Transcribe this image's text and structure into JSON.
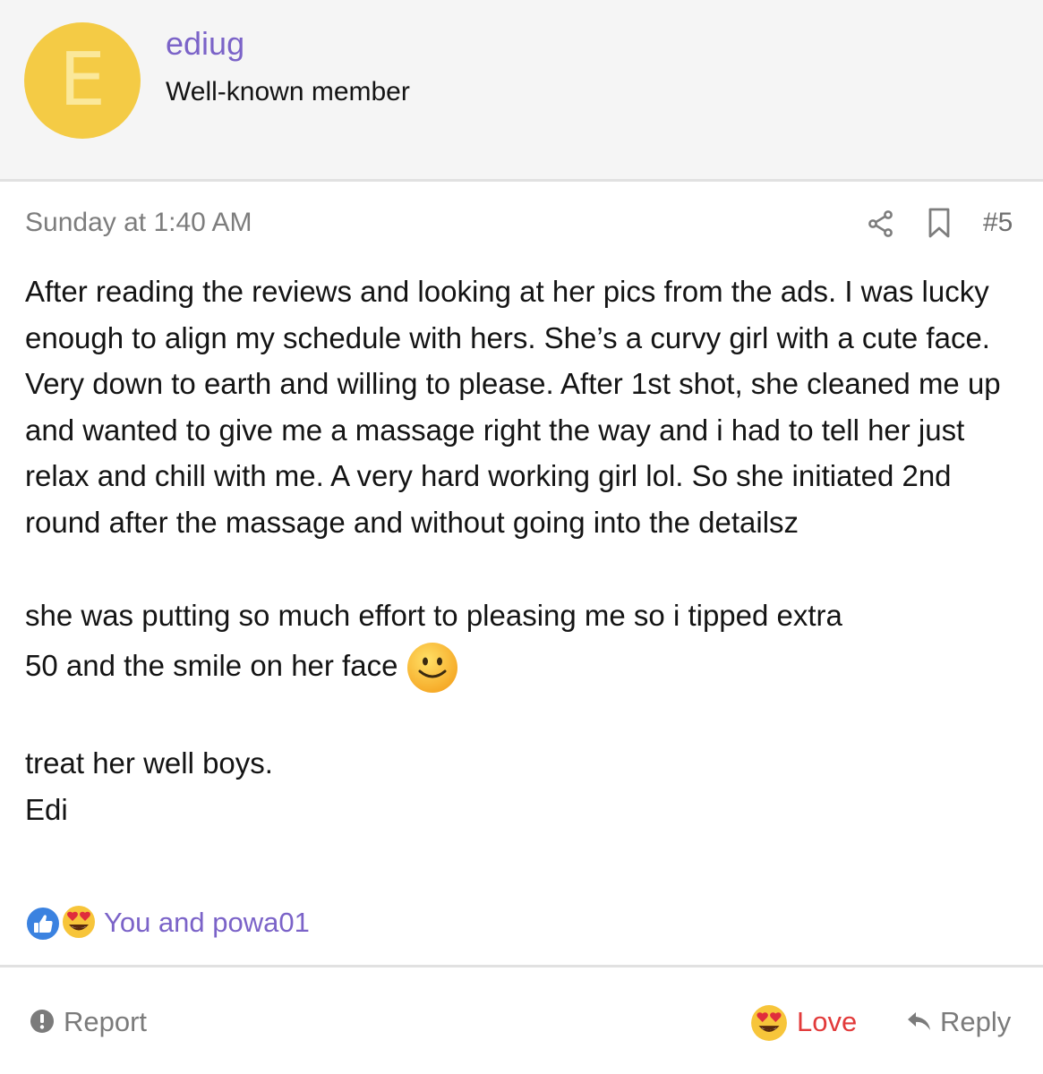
{
  "user": {
    "avatar_letter": "E",
    "name": "ediug",
    "title": "Well-known member"
  },
  "post": {
    "date": "Sunday at 1:40 AM",
    "number": "#5",
    "paragraph1": "After reading the reviews and looking at her pics from the ads. I was lucky enough to align my schedule with hers. She’s a curvy girl with a cute face. Very down to earth and willing to please. After 1st shot, she cleaned me up and wanted to give me a massage right the way and i had to tell her just relax and chill with me. A very hard working girl lol. So she initiated 2nd round after the massage and without going into the detailsz",
    "paragraph2_line1": "she was putting so much effort to pleasing me so i tipped extra",
    "paragraph2_line2": "50 and the smile on her face",
    "paragraph3_line1": "treat her well boys.",
    "paragraph3_line2": "Edi"
  },
  "reactions": {
    "text": "You and powa01",
    "icons": [
      "like-icon",
      "love-eyes-icon"
    ]
  },
  "actions": {
    "report": "Report",
    "love": "Love",
    "reply": "Reply"
  },
  "colors": {
    "accent": "#7b63c8",
    "avatar_bg": "#f4cb45",
    "love": "#e23a3a",
    "muted": "#7d7d7d"
  }
}
